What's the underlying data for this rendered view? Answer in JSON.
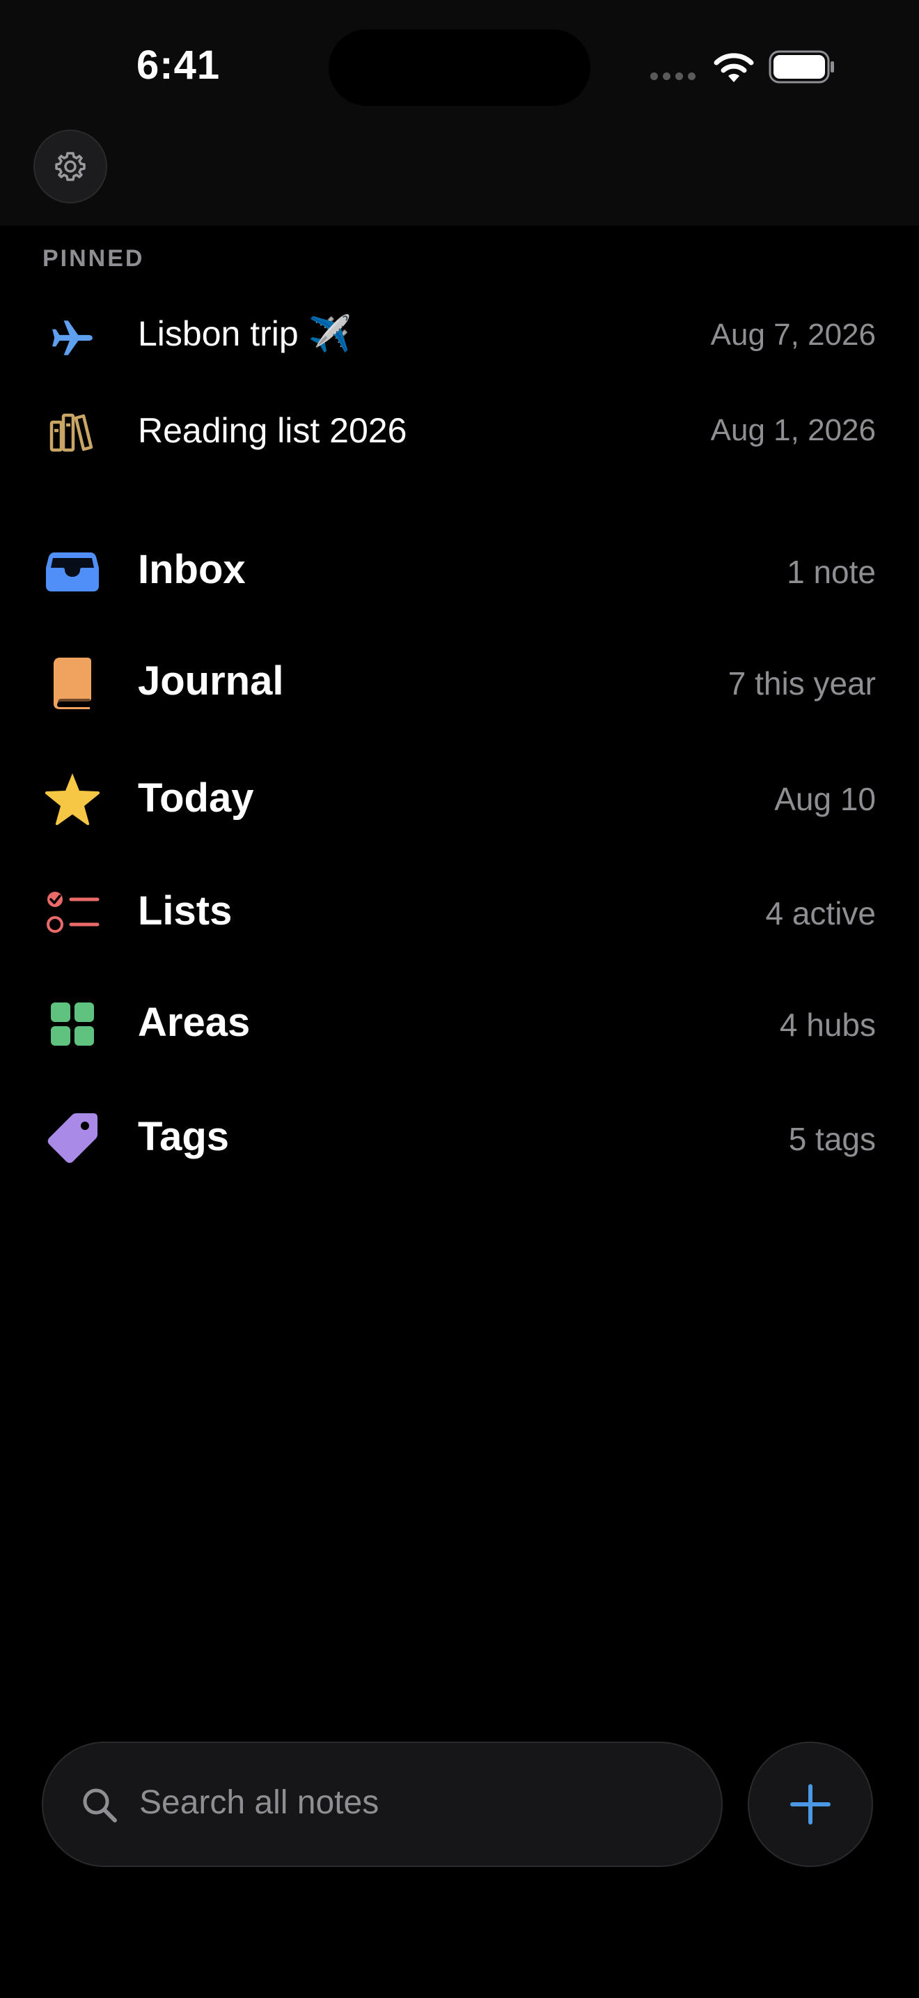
{
  "status_bar": {
    "time": "6:41"
  },
  "header": {
    "settings_icon": "gear-icon"
  },
  "pinned": {
    "label": "PINNED",
    "items": [
      {
        "icon": "airplane-icon",
        "title": "Lisbon trip ✈️",
        "date": "Aug 7, 2026",
        "icon_color": "#5e9ff0"
      },
      {
        "icon": "books-icon",
        "title": "Reading list 2026",
        "date": "Aug 1, 2026",
        "icon_color": "#c9a566"
      }
    ]
  },
  "nav": {
    "items": [
      {
        "icon": "inbox-tray-icon",
        "label": "Inbox",
        "meta": "1 note",
        "icon_color": "#4f8ff7"
      },
      {
        "icon": "journal-book-icon",
        "label": "Journal",
        "meta": "7 this year",
        "icon_color": "#f0a35e"
      },
      {
        "icon": "star-icon",
        "label": "Today",
        "meta": "Aug 10",
        "icon_color": "#f6c744"
      },
      {
        "icon": "checklist-icon",
        "label": "Lists",
        "meta": "4 active",
        "icon_color": "#ea6a6a"
      },
      {
        "icon": "grid-squares-icon",
        "label": "Areas",
        "meta": "4 hubs",
        "icon_color": "#5fc27e"
      },
      {
        "icon": "tag-icon",
        "label": "Tags",
        "meta": "5 tags",
        "icon_color": "#a98ae6"
      }
    ]
  },
  "search": {
    "placeholder": "Search all notes"
  },
  "add_button": {
    "icon": "plus-icon",
    "color": "#4a98e6"
  }
}
